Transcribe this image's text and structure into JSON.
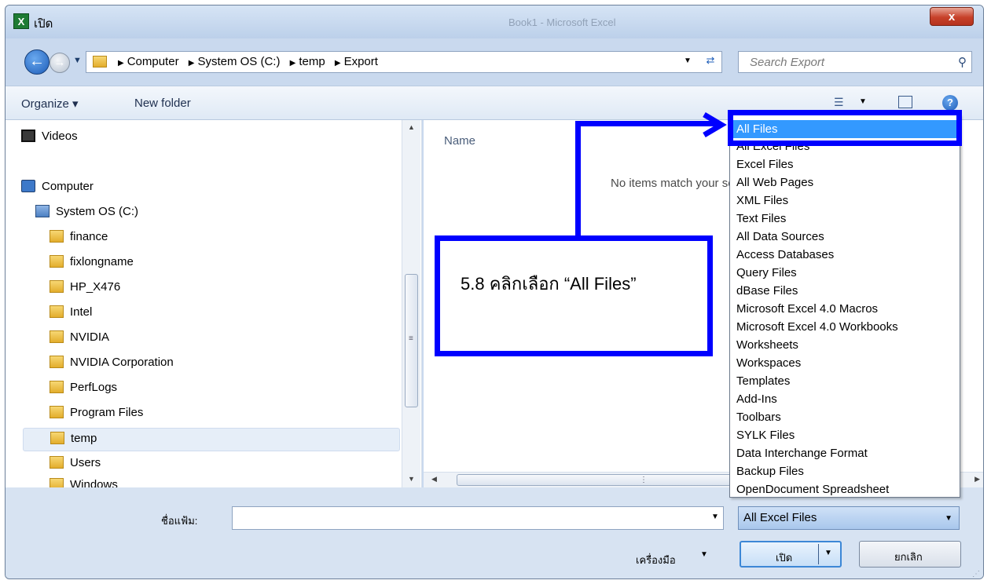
{
  "window": {
    "title": "เปิด",
    "app_icon": "excel-icon",
    "app_icon_glyph": "X",
    "bg_title_faded": "Book1 - Microsoft Excel",
    "close_glyph": "x"
  },
  "address": {
    "crumbs": [
      "Computer",
      "System OS (C:)",
      "temp",
      "Export"
    ],
    "search_placeholder": "Search Export"
  },
  "toolbar": {
    "organize": "Organize ▾",
    "new_folder": "New folder"
  },
  "nav": {
    "items": [
      {
        "label": "Videos",
        "icon": "video-icon"
      },
      {
        "label": "Computer",
        "icon": "computer-icon"
      },
      {
        "label": "System OS (C:)",
        "icon": "drive-icon"
      },
      {
        "label": "finance",
        "icon": "folder-icon"
      },
      {
        "label": "fixlongname",
        "icon": "folder-icon"
      },
      {
        "label": "HP_X476",
        "icon": "folder-icon"
      },
      {
        "label": "Intel",
        "icon": "folder-icon"
      },
      {
        "label": "NVIDIA",
        "icon": "folder-icon"
      },
      {
        "label": "NVIDIA Corporation",
        "icon": "folder-icon"
      },
      {
        "label": "PerfLogs",
        "icon": "folder-icon"
      },
      {
        "label": "Program Files",
        "icon": "folder-icon"
      },
      {
        "label": "temp",
        "icon": "folder-icon",
        "selected": true
      },
      {
        "label": "Users",
        "icon": "folder-icon"
      },
      {
        "label": "Windows",
        "icon": "folder-icon"
      }
    ]
  },
  "file_pane": {
    "column_name": "Name",
    "empty_message": "No items match your search."
  },
  "file_types": {
    "selected": "All Files",
    "options": [
      "All Files",
      "All Excel Files",
      "Excel Files",
      "All Web Pages",
      "XML Files",
      "Text Files",
      "All Data Sources",
      "Access Databases",
      "Query Files",
      "dBase Files",
      "Microsoft Excel 4.0 Macros",
      "Microsoft Excel 4.0 Workbooks",
      "Worksheets",
      "Workspaces",
      "Templates",
      "Add-Ins",
      "Toolbars",
      "SYLK Files",
      "Data Interchange Format",
      "Backup Files",
      "OpenDocument Spreadsheet"
    ],
    "current_filter": "All Excel Files"
  },
  "bottom": {
    "filename_label": "ชื่อแฟ้ม:",
    "filename_value": "",
    "tools_label": "เครื่องมือ",
    "open_label": "เปิด",
    "cancel_label": "ยกเลิก"
  },
  "annotation": {
    "callout_text": "5.8 คลิกเลือก “All Files”",
    "color": "#0000ff"
  }
}
